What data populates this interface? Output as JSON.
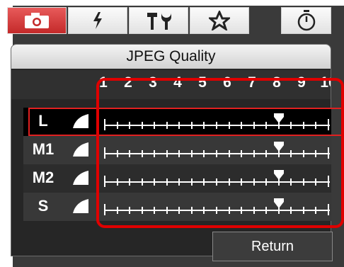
{
  "tabs": [
    {
      "name": "camera-icon",
      "active": true
    },
    {
      "name": "flash-icon",
      "active": false
    },
    {
      "name": "tools-icon",
      "active": false
    },
    {
      "name": "star-icon",
      "active": false
    }
  ],
  "timer_icon": "timer-icon",
  "panel": {
    "title": "JPEG Quality",
    "scale": [
      "1",
      "2",
      "3",
      "4",
      "5",
      "6",
      "7",
      "8",
      "9",
      "10"
    ],
    "rows": [
      {
        "label": "L",
        "icon": "fine-quality-icon",
        "value": 8,
        "selected": true
      },
      {
        "label": "M1",
        "icon": "fine-quality-icon",
        "value": 8,
        "selected": false
      },
      {
        "label": "M2",
        "icon": "fine-quality-icon",
        "value": 8,
        "selected": false
      },
      {
        "label": "S",
        "icon": "fine-quality-icon",
        "value": 8,
        "selected": false
      }
    ]
  },
  "return_label": "Return",
  "colors": {
    "accent": "#e00000",
    "active_tab": "#d43a3a",
    "panel_bg": "#262626"
  }
}
